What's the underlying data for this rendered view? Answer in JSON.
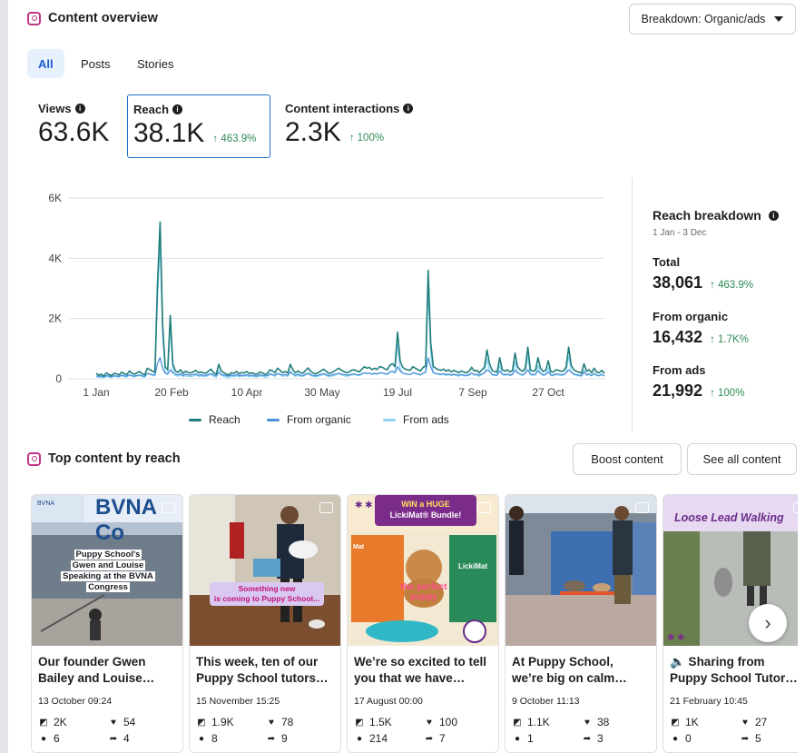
{
  "header": {
    "title": "Content overview",
    "breakdown_label": "Breakdown: Organic/ads"
  },
  "tabs": [
    "All",
    "Posts",
    "Stories"
  ],
  "metrics": [
    {
      "label": "Views",
      "value": "63.6K",
      "change": ""
    },
    {
      "label": "Reach",
      "value": "38.1K",
      "change": "↑ 463.9%"
    },
    {
      "label": "Content interactions",
      "value": "2.3K",
      "change": "↑ 100%"
    }
  ],
  "chart_data": {
    "type": "line",
    "x_ticks": [
      "1 Jan",
      "20 Feb",
      "10 Apr",
      "30 May",
      "19 Jul",
      "7 Sep",
      "27 Oct"
    ],
    "y_ticks": [
      "6K",
      "4K",
      "2K",
      "0"
    ],
    "ylim": [
      0,
      6000
    ],
    "series": [
      {
        "name": "Reach",
        "color": "#1f7d7a",
        "values": [
          180,
          120,
          150,
          90,
          200,
          140,
          110,
          180,
          160,
          130,
          220,
          170,
          140,
          260,
          180,
          150,
          200,
          240,
          170,
          130,
          350,
          300,
          260,
          210,
          3100,
          5200,
          1800,
          400,
          300,
          2100,
          500,
          260,
          210,
          300,
          180,
          250,
          210,
          190,
          230,
          280,
          200,
          220,
          200,
          180,
          260,
          320,
          200,
          150,
          480,
          250,
          200,
          150,
          130,
          200,
          180,
          240,
          160,
          210,
          190,
          240,
          170,
          200,
          160,
          150,
          220,
          200,
          150,
          170,
          300,
          260,
          200,
          350,
          280,
          200,
          240,
          190,
          480,
          300,
          200,
          260,
          200,
          190,
          280,
          360,
          240,
          190,
          160,
          210,
          260,
          320,
          250,
          180,
          200,
          240,
          300,
          350,
          280,
          240,
          200,
          230,
          280,
          300,
          260,
          230,
          320,
          400,
          350,
          380,
          300,
          350,
          310,
          400,
          380,
          330,
          300,
          450,
          500,
          400,
          1550,
          600,
          380,
          320,
          300,
          280,
          400,
          350,
          300,
          260,
          380,
          420,
          3600,
          1200,
          400,
          350,
          300,
          280,
          320,
          250,
          300,
          230,
          280,
          240,
          200,
          260,
          220,
          200,
          250,
          380,
          260,
          280,
          200,
          300,
          380,
          960,
          500,
          280,
          240,
          220,
          700,
          300,
          250,
          300,
          220,
          280,
          850,
          400,
          300,
          240,
          360,
          1050,
          300,
          250,
          280,
          700,
          350,
          240,
          280,
          600,
          230,
          220,
          300,
          280,
          250,
          260,
          400,
          1050,
          450,
          300,
          250,
          220,
          180,
          500,
          250,
          300,
          200,
          350,
          220,
          200,
          280,
          180
        ]
      },
      {
        "name": "From organic",
        "color": "#4a90d9",
        "values": [
          100,
          80,
          90,
          60,
          110,
          90,
          70,
          100,
          90,
          80,
          120,
          100,
          90,
          130,
          100,
          90,
          110,
          130,
          100,
          80,
          180,
          160,
          140,
          120,
          500,
          700,
          350,
          180,
          160,
          300,
          200,
          150,
          130,
          170,
          110,
          150,
          130,
          120,
          140,
          160,
          120,
          130,
          120,
          110,
          150,
          170,
          120,
          100,
          200,
          140,
          120,
          100,
          90,
          120,
          110,
          140,
          100,
          120,
          110,
          140,
          100,
          120,
          100,
          90,
          130,
          120,
          100,
          110,
          160,
          140,
          120,
          180,
          150,
          120,
          140,
          110,
          220,
          160,
          120,
          150,
          120,
          110,
          160,
          190,
          140,
          110,
          100,
          120,
          150,
          170,
          140,
          110,
          120,
          140,
          160,
          180,
          150,
          140,
          120,
          130,
          150,
          160,
          140,
          130,
          170,
          200,
          180,
          190,
          160,
          180,
          160,
          200,
          190,
          170,
          160,
          220,
          240,
          200,
          400,
          260,
          190,
          160,
          150,
          140,
          200,
          180,
          160,
          140,
          190,
          210,
          700,
          400,
          200,
          180,
          160,
          150,
          170,
          140,
          160,
          130,
          150,
          130,
          120,
          140,
          120,
          110,
          140,
          190,
          140,
          150,
          120,
          160,
          190,
          300,
          240,
          150,
          130,
          120,
          250,
          160,
          140,
          160,
          120,
          150,
          280,
          200,
          160,
          130,
          180,
          300,
          160,
          140,
          150,
          260,
          180,
          130,
          150,
          220,
          130,
          120,
          160,
          150,
          140,
          140,
          200,
          300,
          220,
          160,
          140,
          120,
          100,
          220,
          140,
          160,
          110,
          180,
          120,
          110,
          150,
          100
        ]
      },
      {
        "name": "From ads",
        "color": "#8fd3f4",
        "values": [
          80,
          40,
          60,
          30,
          90,
          50,
          40,
          80,
          70,
          50,
          100,
          70,
          50,
          130,
          80,
          60,
          90,
          110,
          70,
          50,
          170,
          140,
          120,
          90,
          2600,
          4500,
          1450,
          220,
          140,
          1800,
          300,
          110,
          80,
          130,
          70,
          100,
          80,
          70,
          90,
          120,
          80,
          90,
          80,
          70,
          110,
          150,
          80,
          50,
          280,
          110,
          80,
          50,
          40,
          80,
          70,
          100,
          60,
          90,
          80,
          100,
          70,
          80,
          60,
          60,
          90,
          80,
          50,
          60,
          140,
          120,
          80,
          170,
          130,
          80,
          100,
          80,
          260,
          140,
          80,
          110,
          80,
          80,
          120,
          170,
          100,
          80,
          60,
          90,
          110,
          150,
          110,
          70,
          80,
          100,
          140,
          170,
          130,
          100,
          80,
          100,
          130,
          140,
          120,
          100,
          150,
          200,
          170,
          190,
          140,
          170,
          150,
          200,
          190,
          160,
          140,
          230,
          260,
          200,
          1150,
          340,
          190,
          160,
          150,
          140,
          200,
          170,
          140,
          120,
          190,
          210,
          2900,
          800,
          200,
          170,
          140,
          130,
          150,
          110,
          140,
          100,
          130,
          110,
          80,
          120,
          100,
          90,
          110,
          190,
          120,
          130,
          80,
          140,
          190,
          660,
          260,
          130,
          110,
          100,
          450,
          140,
          110,
          140,
          100,
          130,
          570,
          200,
          140,
          110,
          180,
          750,
          140,
          110,
          130,
          440,
          170,
          110,
          130,
          380,
          100,
          100,
          140,
          130,
          110,
          120,
          200,
          750,
          230,
          140,
          110,
          100,
          80,
          280,
          110,
          140,
          90,
          170,
          100,
          90,
          130,
          80
        ]
      }
    ],
    "legend_position": "bottom",
    "grid": true
  },
  "reach_breakdown": {
    "title": "Reach breakdown",
    "date_range": "1 Jan - 3 Dec",
    "rows": [
      {
        "label": "Total",
        "value": "38,061",
        "change": "↑ 463.9%"
      },
      {
        "label": "From organic",
        "value": "16,432",
        "change": "↑ 1.7K%"
      },
      {
        "label": "From ads",
        "value": "21,992",
        "change": "↑ 100%"
      }
    ]
  },
  "top_content": {
    "title": "Top content by reach",
    "boost_label": "Boost content",
    "see_all_label": "See all content",
    "cards": [
      {
        "caption_l1": "Our founder Gwen",
        "caption_l2": "Bailey and Louise…",
        "date": "13 October 09:24",
        "views": "2K",
        "likes": "54",
        "comments": "6",
        "shares": "4",
        "overlay": [
          "Puppy School's",
          "Gwen and Louise",
          "Speaking at the BVNA",
          "Congress"
        ],
        "banner": "BVNA Co",
        "brand": "BVNA"
      },
      {
        "caption_l1": "This week, ten of our",
        "caption_l2": "Puppy School tutors…",
        "date": "15 November 15:25",
        "views": "1.9K",
        "likes": "78",
        "comments": "8",
        "shares": "9",
        "overlay": [
          "Something new",
          "is coming to Puppy School..."
        ]
      },
      {
        "caption_l1": "We’re so excited to tell",
        "caption_l2": "you that we have…",
        "date": "17 August 00:00",
        "views": "1.5K",
        "likes": "100",
        "comments": "214",
        "shares": "7",
        "overlay": [
          "WIN a HUGE",
          "LickiMat® Bundle!"
        ],
        "logo_text": "LickiMat",
        "brand_mini": "Mat",
        "promo": "the perfect puppy"
      },
      {
        "caption_l1": "At Puppy School,",
        "caption_l2": "we’re big on calm…",
        "date": "9 October 11:13",
        "views": "1.1K",
        "likes": "38",
        "comments": "1",
        "shares": "3"
      },
      {
        "caption_l1": "🔈 Sharing from",
        "caption_l2": "Puppy School Tutor…",
        "date": "21 February 10:45",
        "views": "1K",
        "likes": "27",
        "comments": "0",
        "shares": "5",
        "overlay": [
          "Loose Lead Walking"
        ]
      }
    ]
  }
}
